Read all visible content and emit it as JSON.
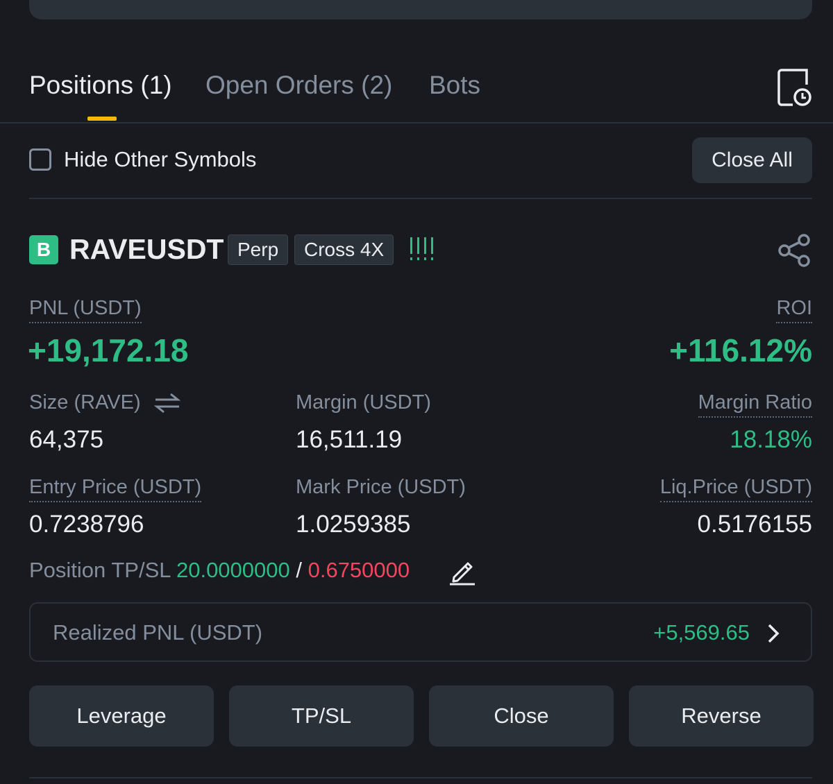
{
  "tabs": [
    {
      "label": "Positions (1)",
      "active": true
    },
    {
      "label": "Open Orders (2)",
      "active": false
    },
    {
      "label": "Bots",
      "active": false
    }
  ],
  "filter": {
    "hide_other_label": "Hide Other Symbols",
    "checked": false,
    "close_all_label": "Close All"
  },
  "position": {
    "side_badge": "B",
    "symbol": "RAVEUSDT",
    "contract_tag": "Perp",
    "margin_tag": "Cross 4X",
    "pnl_label": "PNL (USDT)",
    "pnl_value": "+19,172.18",
    "roi_label": "ROI",
    "roi_value": "+116.12%",
    "size_label": "Size (RAVE)",
    "size_value": "64,375",
    "margin_label": "Margin (USDT)",
    "margin_value": "16,511.19",
    "margin_ratio_label": "Margin Ratio",
    "margin_ratio_value": "18.18%",
    "entry_label": "Entry Price (USDT)",
    "entry_value": "0.7238796",
    "mark_label": "Mark Price (USDT)",
    "mark_value": "1.0259385",
    "liq_label": "Liq.Price (USDT)",
    "liq_value": "0.5176155",
    "tpsl_label": "Position TP/SL",
    "tp_value": "20.0000000",
    "tpsl_separator": " / ",
    "sl_value": "0.6750000",
    "realized_label": "Realized PNL (USDT)",
    "realized_value": "+5,569.65"
  },
  "actions": {
    "leverage": "Leverage",
    "tpsl": "TP/SL",
    "close": "Close",
    "reverse": "Reverse"
  },
  "colors": {
    "background": "#181A20",
    "card": "#2B3139",
    "accent": "#F0B90B",
    "profit": "#2EBD85",
    "loss": "#F6465D",
    "muted": "#848E9C"
  },
  "icons": {
    "history": "order-history-icon",
    "share": "share-icon",
    "swap": "swap-arrows-icon",
    "edit": "pencil-edit-icon",
    "chevron": "chevron-right-icon",
    "risk": "risk-level-bars-icon"
  }
}
